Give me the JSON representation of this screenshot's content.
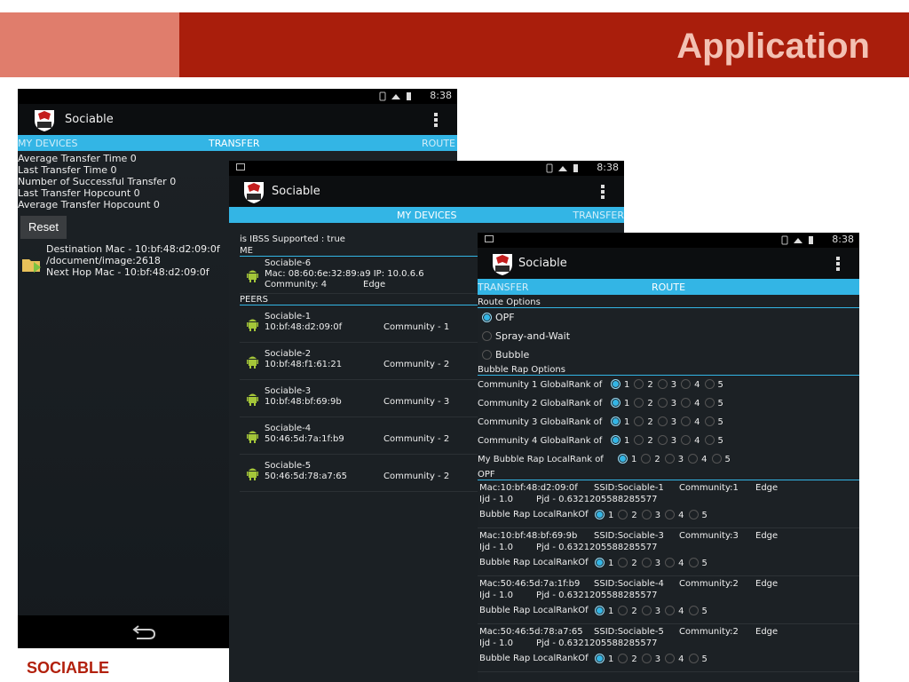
{
  "slide": {
    "title": "Application",
    "footer": "SOCIABLE"
  },
  "colors": {
    "accent": "#33b5e5",
    "header": "#a91e0c",
    "header_light": "#e07d6c"
  },
  "status_time": "8:38",
  "app_name": "Sociable",
  "phone1": {
    "tabs": [
      "MY DEVICES",
      "TRANSFER",
      "ROUTE"
    ],
    "stats": [
      "Average Transfer Time 0",
      "Last Transfer Time 0",
      "Number of Successful Transfer 0",
      "Last Transfer Hopcount 0",
      "Average Transfer Hopcount 0"
    ],
    "reset_label": "Reset",
    "transfer": {
      "dest": "Destination Mac - 10:bf:48:d2:09:0f",
      "path": "/document/image:2618",
      "next_hop": "Next Hop Mac - 10:bf:48:d2:09:0f"
    },
    "nav_back_icon": "back-arrow-icon"
  },
  "phone2": {
    "tabs": [
      "MY DEVICES",
      "TRANSFER"
    ],
    "ibss": "is IBSS Supported : true",
    "me_label": "ME",
    "me": {
      "name": "Sociable-6",
      "mac": "Mac: 08:60:6e:32:89:a9  IP: 10.0.6.6",
      "community": "Community: 4",
      "edge": "Edge"
    },
    "peers_label": "PEERS",
    "peers": [
      {
        "name": "Sociable-1",
        "mac": "10:bf:48:d2:09:0f",
        "community": "Community - 1"
      },
      {
        "name": "Sociable-2",
        "mac": "10:bf:48:f1:61:21",
        "community": "Community - 2"
      },
      {
        "name": "Sociable-3",
        "mac": "10:bf:48:bf:69:9b",
        "community": "Community - 3"
      },
      {
        "name": "Sociable-4",
        "mac": "50:46:5d:7a:1f:b9",
        "community": "Community - 2"
      },
      {
        "name": "Sociable-5",
        "mac": "50:46:5d:78:a7:65",
        "community": "Community - 2"
      }
    ]
  },
  "phone3": {
    "tabs": [
      "TRANSFER",
      "ROUTE"
    ],
    "route_options_label": "Route Options",
    "route_options": [
      {
        "label": "OPF",
        "selected": true
      },
      {
        "label": "Spray-and-Wait",
        "selected": false
      },
      {
        "label": "Bubble",
        "selected": false
      }
    ],
    "bubble_label": "Bubble Rap Options",
    "rank_values": [
      "1",
      "2",
      "3",
      "4",
      "5"
    ],
    "bubble_rows": [
      {
        "label": "Community 1 GlobalRank of",
        "selected": 1
      },
      {
        "label": "Community 2 GlobalRank of",
        "selected": 1
      },
      {
        "label": "Community 3 GlobalRank of",
        "selected": 1
      },
      {
        "label": "Community 4 GlobalRank of",
        "selected": 1
      },
      {
        "label": "My Bubble Rap LocalRank of",
        "selected": 1
      }
    ],
    "opf_label": "OPF",
    "opf_rows": [
      {
        "mac": "Mac:10:bf:48:d2:09:0f",
        "ssid": "SSID:Sociable-1",
        "community": "Community:1",
        "edge": "Edge",
        "ijd": "Ijd - 1.0",
        "pjd": "Pjd - 0.6321205588285577",
        "local_label": "Bubble Rap LocalRankOf",
        "selected": 1
      },
      {
        "mac": "Mac:10:bf:48:bf:69:9b",
        "ssid": "SSID:Sociable-3",
        "community": "Community:3",
        "edge": "Edge",
        "ijd": "Ijd - 1.0",
        "pjd": "Pjd - 0.6321205588285577",
        "local_label": "Bubble Rap LocalRankOf",
        "selected": 1
      },
      {
        "mac": "Mac:50:46:5d:7a:1f:b9",
        "ssid": "SSID:Sociable-4",
        "community": "Community:2",
        "edge": "Edge",
        "ijd": "Ijd - 1.0",
        "pjd": "Pjd - 0.6321205588285577",
        "local_label": "Bubble Rap LocalRankOf",
        "selected": 1
      },
      {
        "mac": "Mac:50:46:5d:78:a7:65",
        "ssid": "SSID:Sociable-5",
        "community": "Community:2",
        "edge": "Edge",
        "ijd": "Ijd - 1.0",
        "pjd": "Pjd - 0.6321205588285577",
        "local_label": "Bubble Rap LocalRankOf",
        "selected": 1
      }
    ]
  }
}
